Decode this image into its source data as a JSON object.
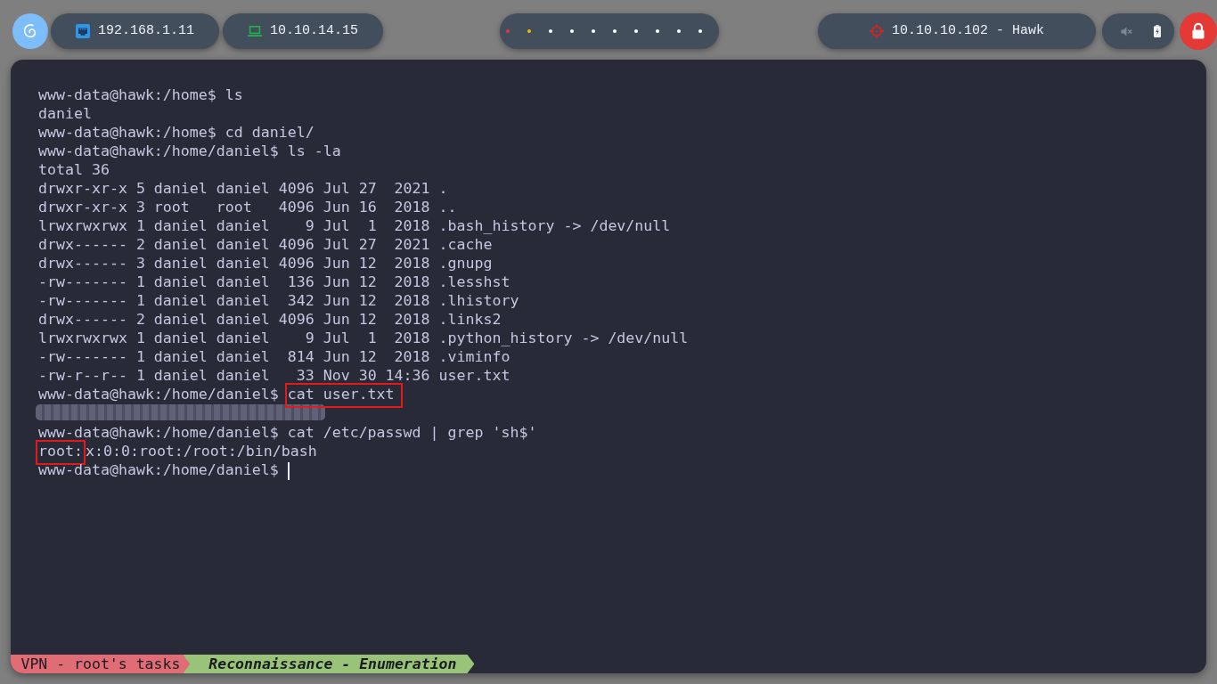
{
  "top_bar": {
    "network": [
      {
        "kind": "ethernet",
        "address": "192.168.1.11"
      },
      {
        "kind": "vpn",
        "address": "10.10.14.15"
      }
    ],
    "workspaces": [
      {
        "color": "#e53935"
      },
      {
        "color": "#f5b800"
      },
      {
        "color": "#ffffff"
      },
      {
        "color": "#ffffff"
      },
      {
        "color": "#ffffff"
      },
      {
        "color": "#ffffff"
      },
      {
        "color": "#ffffff"
      },
      {
        "color": "#ffffff"
      },
      {
        "color": "#ffffff"
      },
      {
        "color": "#ffffff"
      }
    ],
    "target": {
      "text": "10.10.10.102 - Hawk"
    }
  },
  "terminal": {
    "lines": [
      {
        "kind": "prompt",
        "segments": [
          {
            "text": "www-data@hawk:/home$",
            "highlighted": false
          },
          {
            "text": "ls",
            "highlighted": false
          }
        ]
      },
      {
        "kind": "output",
        "segments": [
          {
            "text": "daniel",
            "highlighted": false
          }
        ]
      },
      {
        "kind": "prompt",
        "segments": [
          {
            "text": "www-data@hawk:/home$",
            "highlighted": false
          },
          {
            "text": "cd daniel/",
            "highlighted": false
          }
        ]
      },
      {
        "kind": "prompt",
        "segments": [
          {
            "text": "www-data@hawk:/home/daniel$",
            "highlighted": false
          },
          {
            "text": "ls -la",
            "highlighted": false
          }
        ]
      },
      {
        "kind": "output",
        "segments": [
          {
            "text": "total 36",
            "highlighted": false
          }
        ]
      },
      {
        "kind": "output",
        "segments": [
          {
            "text": "drwxr-xr-x 5 daniel daniel 4096 Jul 27  2021 .",
            "highlighted": false
          }
        ]
      },
      {
        "kind": "output",
        "segments": [
          {
            "text": "drwxr-xr-x 3 root   root   4096 Jun 16  2018 ..",
            "highlighted": false
          }
        ]
      },
      {
        "kind": "output",
        "segments": [
          {
            "text": "lrwxrwxrwx 1 daniel daniel    9 Jul  1  2018 .bash_history -> /dev/null",
            "highlighted": false
          }
        ]
      },
      {
        "kind": "output",
        "segments": [
          {
            "text": "drwx------ 2 daniel daniel 4096 Jul 27  2021 .cache",
            "highlighted": false
          }
        ]
      },
      {
        "kind": "output",
        "segments": [
          {
            "text": "drwx------ 3 daniel daniel 4096 Jun 12  2018 .gnupg",
            "highlighted": false
          }
        ]
      },
      {
        "kind": "output",
        "segments": [
          {
            "text": "-rw------- 1 daniel daniel  136 Jun 12  2018 .lesshst",
            "highlighted": false
          }
        ]
      },
      {
        "kind": "output",
        "segments": [
          {
            "text": "-rw------- 1 daniel daniel  342 Jun 12  2018 .lhistory",
            "highlighted": false
          }
        ]
      },
      {
        "kind": "output",
        "segments": [
          {
            "text": "drwx------ 2 daniel daniel 4096 Jun 12  2018 .links2",
            "highlighted": false
          }
        ]
      },
      {
        "kind": "output",
        "segments": [
          {
            "text": "lrwxrwxrwx 1 daniel daniel    9 Jul  1  2018 .python_history -> /dev/null",
            "highlighted": false
          }
        ]
      },
      {
        "kind": "output",
        "segments": [
          {
            "text": "-rw------- 1 daniel daniel  814 Jun 12  2018 .viminfo",
            "highlighted": false
          }
        ]
      },
      {
        "kind": "output",
        "segments": [
          {
            "text": "-rw-r--r-- 1 daniel daniel   33 Nov 30 14:36 user.txt",
            "highlighted": false
          }
        ]
      },
      {
        "kind": "prompt",
        "segments": [
          {
            "text": "www-data@hawk:/home/daniel$",
            "highlighted": false
          },
          {
            "text": "cat user.txt",
            "highlighted": true
          }
        ]
      },
      {
        "kind": "redacted"
      },
      {
        "kind": "prompt",
        "segments": [
          {
            "text": "www-data@hawk:/home/daniel$",
            "highlighted": false
          },
          {
            "text": "cat /etc/passwd | grep 'sh$'",
            "highlighted": false
          }
        ]
      },
      {
        "kind": "output",
        "segments": [
          {
            "text": "root:",
            "highlighted": true
          },
          {
            "text": "x:0:0:root:/root:/bin/bash",
            "highlighted": false
          }
        ]
      },
      {
        "kind": "input",
        "segments": [
          {
            "text": "www-data@hawk:/home/daniel$",
            "highlighted": false
          }
        ]
      }
    ]
  },
  "status_bar": {
    "segments": [
      {
        "kind": "session",
        "text": "VPN - root's tasks",
        "color": "#e06c75"
      },
      {
        "kind": "window",
        "text": "Reconnaissance - Enumeration",
        "color": "#98c379"
      }
    ]
  }
}
